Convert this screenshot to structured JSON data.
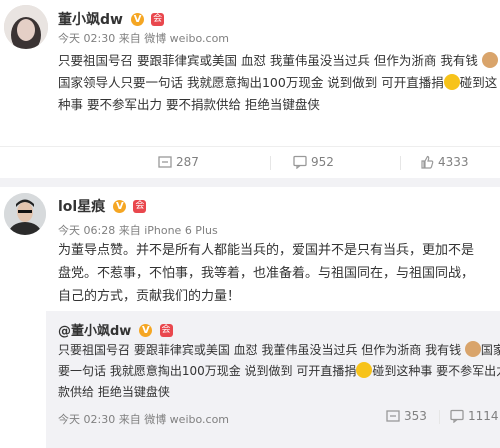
{
  "post1": {
    "username": "董小飒dw",
    "meta": "今天 02:30 来自 微博 weibo.com",
    "line1": "只要祖国号召 要跟菲律宾或美国 血怼 我董伟虽没当过兵 但作为浙商 我有钱",
    "line2a": "国家领导人只要一句话 我就愿意掏出100万现金 说到做到 可开直播捐",
    "line2b": "碰到这",
    "line3": "种事 要不参军出力 要不捐款供给 拒绝当键盘侠",
    "reposts": "287",
    "comments": "952",
    "likes": "4333"
  },
  "post2": {
    "username": "lol星痕",
    "meta": "今天 06:28 来自 iPhone 6 Plus",
    "line1": "为董导点赞。并不是所有人都能当兵的，爱国并不是只有当兵，更加不是",
    "line2": "盘党。不惹事，不怕事，我等着，也准备着。与祖国同在，与祖国同战，",
    "line3": "自己的方式，贡献我们的力量！"
  },
  "quoted": {
    "username": "@董小飒dw",
    "line1a": "只要祖国号召 要跟菲律宾或美国 血怼 我董伟虽没当过兵 但作为浙商 我有钱",
    "line1b": "国家",
    "line2": "要一句话 我就愿意掏出100万现金 说到做到 可开直播捐",
    "line2b": "碰到这种事 要不参军出力 要不捐",
    "line3": "款供给 拒绝当键盘侠",
    "meta": "今天 02:30 来自 微博 weibo.com",
    "reposts": "353",
    "comments": "1114"
  },
  "icons": {
    "verified": "V",
    "vip": "会"
  },
  "colors": {
    "meta_gray": "#808080",
    "badge_orange": "#f5a623",
    "quote_bg": "#f2f2f5"
  }
}
